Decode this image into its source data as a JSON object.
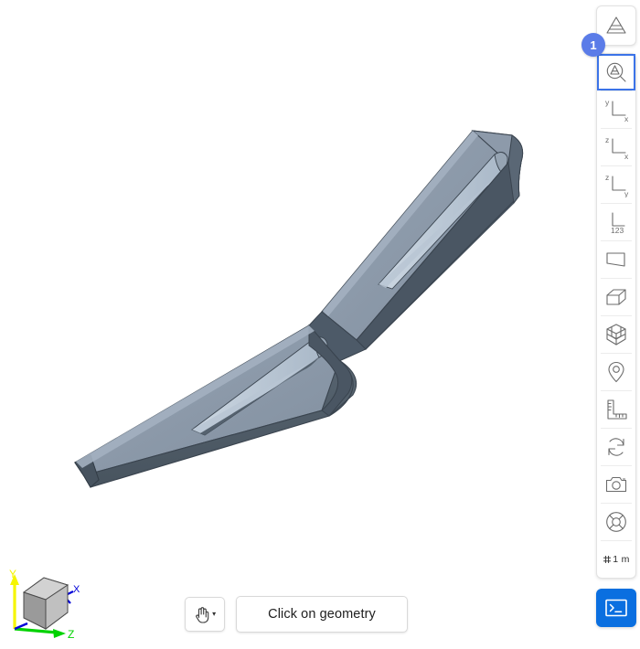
{
  "app": {
    "background_color": "#ffffff",
    "accent_color": "#0a6fe0",
    "badge_color": "#5b7ce8",
    "selection_border_color": "#3b73e8"
  },
  "viewport": {
    "name": "3d-viewport",
    "model_name": "slotted-link-bracket",
    "model_colors": {
      "top_face": "#8e9bab",
      "front_face": "#4d5a68",
      "side_face": "#5d6b7a",
      "slot_inner": "#9fb0c2",
      "slot_highlight": "#c3cfdb",
      "edge": "#3a444f"
    }
  },
  "axis_triad": {
    "name": "axis-triad",
    "axes": [
      {
        "label": "Y",
        "color": "#f5f500"
      },
      {
        "label": "Z",
        "color": "#00d200"
      },
      {
        "label": "X",
        "color": "#0000d8"
      }
    ],
    "cube_color": "#b0b0b0"
  },
  "bottom_bar": {
    "cursor_mode": {
      "icon": "hand-pointer-icon",
      "caret": "▾"
    },
    "action_button_label": "Click on geometry"
  },
  "right_toolbar": {
    "badge": "1",
    "scale_label": "1 m",
    "scale_icon": "scale-hash-icon",
    "top_tool": {
      "name": "mesh-pyramid-icon",
      "tooltip": "Mesh"
    },
    "items": [
      {
        "icon": "zoom-mesh-icon",
        "selected": true
      },
      {
        "icon": "view-yx-icon",
        "label_v": "y",
        "label_h": "x",
        "selected": false
      },
      {
        "icon": "view-zx-icon",
        "label_v": "z",
        "label_h": "x",
        "selected": false
      },
      {
        "icon": "view-zy-icon",
        "label_v": "z",
        "label_h": "y",
        "selected": false
      },
      {
        "icon": "view-iso-123-icon",
        "label_h": "123",
        "selected": false
      },
      {
        "icon": "plane-icon",
        "selected": false
      },
      {
        "icon": "box-icon",
        "selected": false
      },
      {
        "icon": "grid-cube-icon",
        "selected": false
      },
      {
        "icon": "map-pin-icon",
        "selected": false
      },
      {
        "icon": "ruler-measure-icon",
        "selected": false
      },
      {
        "icon": "refresh-sync-icon",
        "selected": false
      },
      {
        "icon": "camera-icon",
        "selected": false
      },
      {
        "icon": "lifebuoy-help-icon",
        "selected": false
      }
    ],
    "terminal_button": {
      "icon": "terminal-icon",
      "color": "#0a6fe0"
    }
  }
}
